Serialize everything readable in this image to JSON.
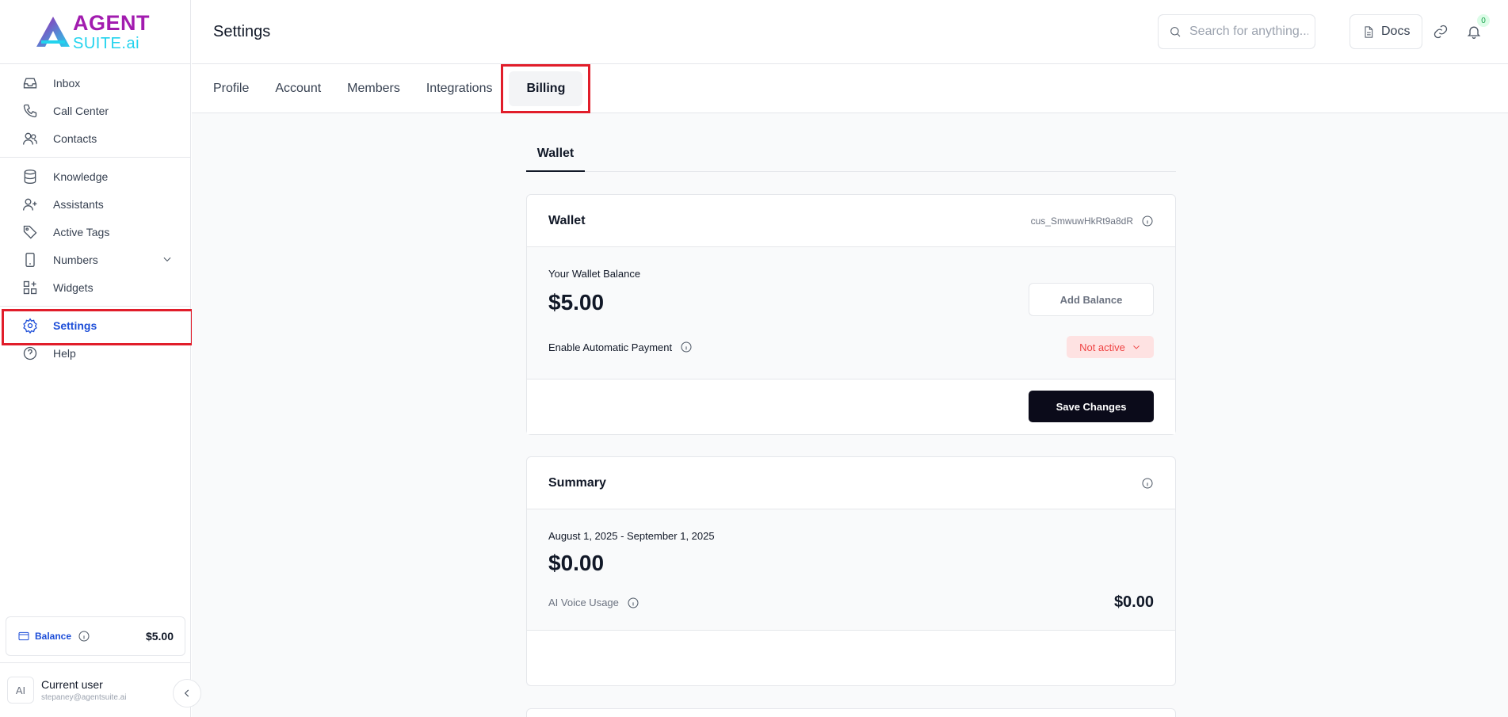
{
  "brand": {
    "line1": "AGENT",
    "line2": "SUITE.ai"
  },
  "sidebar": {
    "groups": [
      {
        "items": [
          {
            "label": "Inbox"
          },
          {
            "label": "Call Center"
          },
          {
            "label": "Contacts"
          }
        ]
      },
      {
        "items": [
          {
            "label": "Knowledge"
          },
          {
            "label": "Assistants"
          },
          {
            "label": "Active Tags"
          },
          {
            "label": "Numbers"
          },
          {
            "label": "Widgets"
          }
        ]
      },
      {
        "items": [
          {
            "label": "Settings"
          },
          {
            "label": "Help"
          }
        ]
      }
    ],
    "balance": {
      "label": "Balance",
      "value": "$5.00"
    },
    "user": {
      "avatar": "AI",
      "name": "Current user",
      "email": "stepaney@agentsuite.ai"
    }
  },
  "header": {
    "title": "Settings",
    "search_placeholder": "Search for anything...",
    "docs_label": "Docs",
    "notification_count": "0"
  },
  "tabs": [
    {
      "label": "Profile"
    },
    {
      "label": "Account"
    },
    {
      "label": "Members"
    },
    {
      "label": "Integrations"
    },
    {
      "label": "Billing"
    }
  ],
  "subtab": "Wallet",
  "wallet": {
    "title": "Wallet",
    "customer_id": "cus_SmwuwHkRt9a8dR",
    "balance_label": "Your Wallet Balance",
    "balance": "$5.00",
    "add_balance_label": "Add Balance",
    "auto_pay_label": "Enable Automatic Payment",
    "auto_pay_status": "Not active",
    "save_label": "Save Changes"
  },
  "summary": {
    "title": "Summary",
    "period": "August 1, 2025 - September 1, 2025",
    "total": "$0.00",
    "usage_label": "AI Voice Usage",
    "usage_value": "$0.00"
  },
  "colors": {
    "accent": "#1d4ed8",
    "highlight": "#e11d2a",
    "primary_button": "#0b0b1a",
    "status_inactive": "#ef4444"
  }
}
